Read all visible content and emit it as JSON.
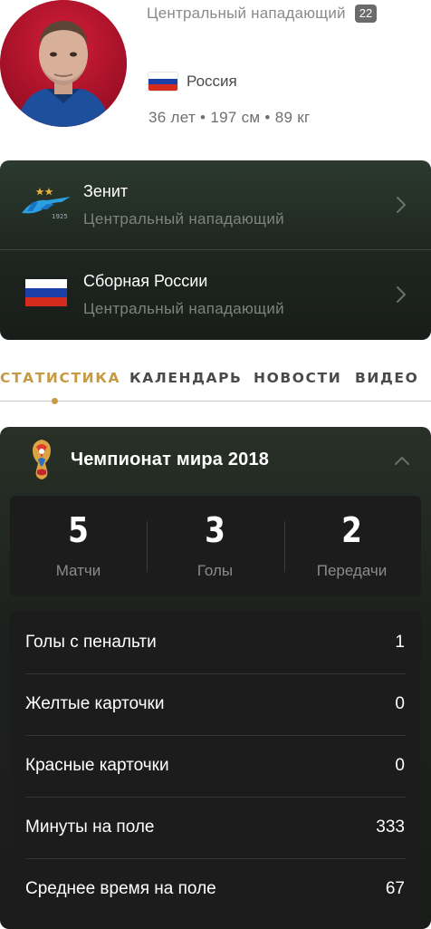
{
  "player": {
    "position": "Центральный нападающий",
    "number": "22",
    "country": "Россия",
    "bio": "36 лет • 197 см • 89 кг",
    "avatar_icon": "player-photo"
  },
  "clubs": [
    {
      "name": "Зенит",
      "role": "Центральный нападающий",
      "logo_icon": "zenit-logo",
      "logo_year": "1925"
    },
    {
      "name": "Сборная России",
      "role": "Центральный нападающий",
      "logo_icon": "russia-flag"
    }
  ],
  "tabs": [
    "СТАТИСТИКА",
    "КАЛЕНДАРЬ",
    "НОВОСТИ",
    "ВИДЕО"
  ],
  "active_tab": "СТАТИСТИКА",
  "competition": {
    "title": "Чемпионат мира 2018",
    "icon": "world-cup-trophy",
    "summary": [
      {
        "value": "5",
        "label": "Матчи"
      },
      {
        "value": "3",
        "label": "Голы"
      },
      {
        "value": "2",
        "label": "Передачи"
      }
    ],
    "details": [
      {
        "label": "Голы с пенальти",
        "value": "1"
      },
      {
        "label": "Желтые карточки",
        "value": "0"
      },
      {
        "label": "Красные карточки",
        "value": "0"
      },
      {
        "label": "Минуты на поле",
        "value": "333"
      },
      {
        "label": "Среднее время на поле",
        "value": "67"
      }
    ]
  },
  "colors": {
    "accent": "#c69a43",
    "russia_flag": [
      "#ffffff",
      "#1c3fa8",
      "#d52b1e"
    ]
  }
}
